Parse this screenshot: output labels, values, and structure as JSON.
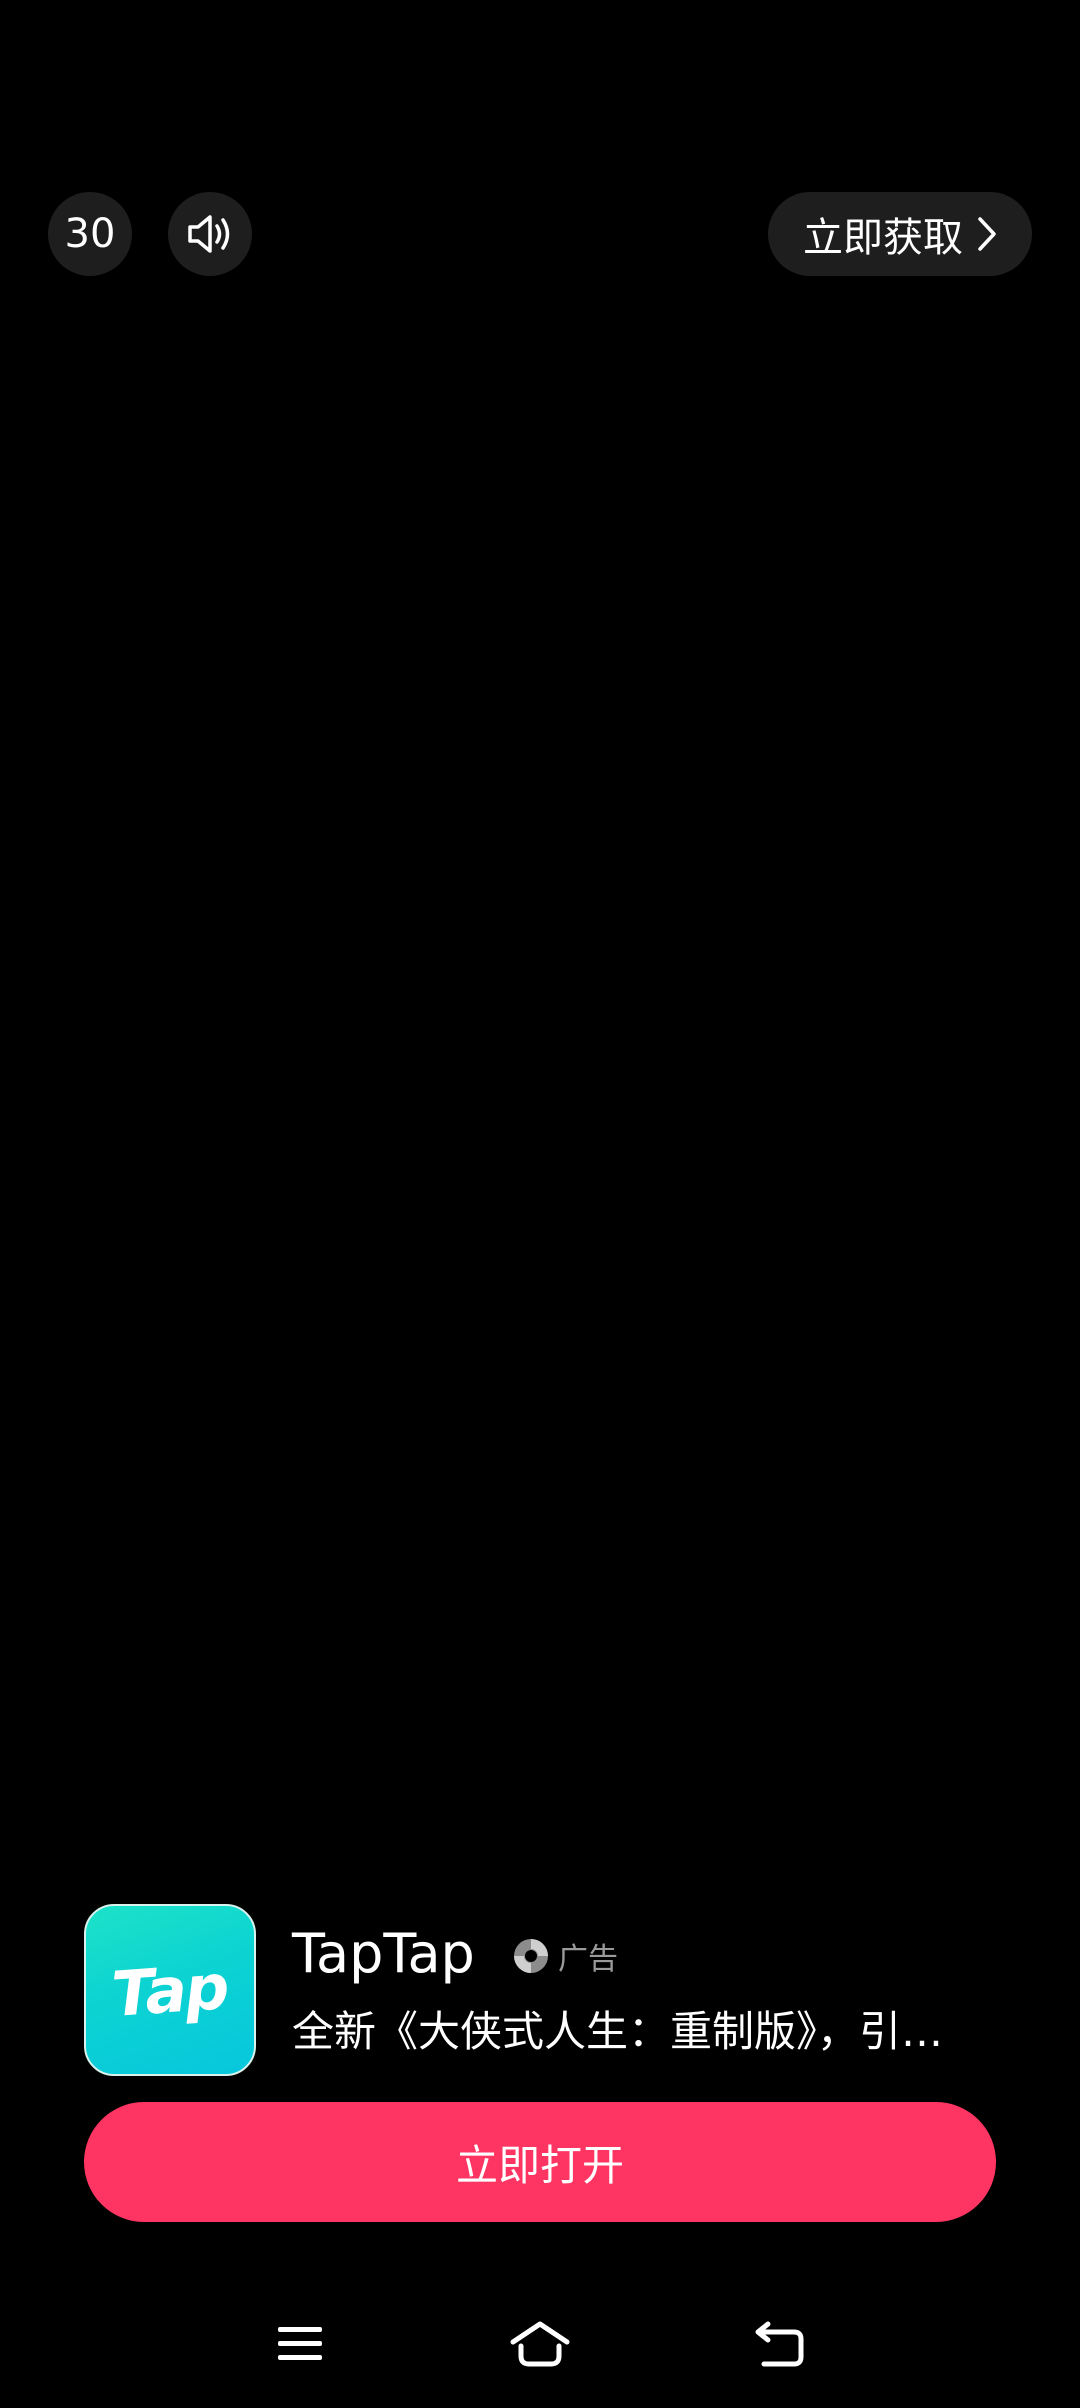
{
  "top_bar": {
    "countdown": "30",
    "mute_icon": "speaker-icon",
    "get_now_label": "立即获取",
    "get_now_icon": "chevron-right-icon"
  },
  "ad_card": {
    "app_icon_text": "Tap",
    "app_name": "TapTap",
    "ad_label": "广告",
    "ad_provider_icon": "ad-provider-icon",
    "description": "全新《大侠式人生：重制版》，引…",
    "open_button": "立即打开",
    "colors": {
      "button": "#fe3563",
      "icon_gradient_start": "#1de2c8",
      "icon_gradient_end": "#07c6dd"
    }
  },
  "nav_bar": {
    "menu_icon": "menu-icon",
    "home_icon": "home-icon",
    "back_icon": "back-icon"
  }
}
